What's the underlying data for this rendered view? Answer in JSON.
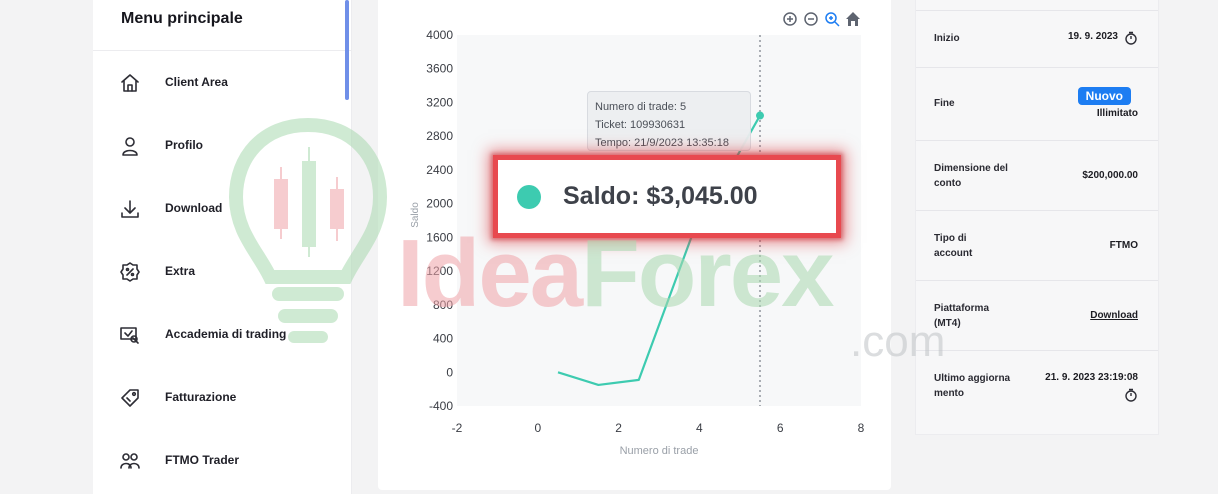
{
  "sidebar": {
    "title": "Menu principale",
    "items": [
      {
        "label": "Client Area",
        "icon": "home-icon"
      },
      {
        "label": "Profilo",
        "icon": "user-icon"
      },
      {
        "label": "Download",
        "icon": "download-icon"
      },
      {
        "label": "Extra",
        "icon": "percent-badge-icon"
      },
      {
        "label": "Accademia di trading",
        "icon": "academy-icon"
      },
      {
        "label": "Fatturazione",
        "icon": "tag-icon"
      },
      {
        "label": "FTMO Trader",
        "icon": "users-icon"
      }
    ]
  },
  "chart": {
    "tools": [
      "zoom-in-icon",
      "zoom-out-icon",
      "magnifier-icon",
      "home-reset-icon"
    ],
    "tooltip": {
      "line1": "Numero di trade: 5",
      "line2": "Ticket: 109930631",
      "line3": "Tempo: 21/9/2023 13:35:18"
    },
    "saldo_label": "Saldo: $3,045.00",
    "saldo_color": "#3dcbb0"
  },
  "chart_data": {
    "type": "line",
    "xlabel": "Numero di trade",
    "ylabel": "Saldo",
    "xlim": [
      -2,
      8
    ],
    "ylim": [
      -400,
      4000
    ],
    "x_ticks": [
      "-2",
      "0",
      "2",
      "4",
      "6",
      "8"
    ],
    "y_ticks": [
      "4000",
      "3600",
      "3200",
      "2800",
      "2400",
      "2000",
      "1600",
      "1200",
      "800",
      "400",
      "0",
      "-400"
    ],
    "series": [
      {
        "x": [
          0.5,
          1.5,
          2.5,
          3.8,
          5.5
        ],
        "y": [
          0,
          -150,
          -90,
          1600,
          3045
        ],
        "color": "#3dcbb0"
      }
    ],
    "cursor_x": 5.5
  },
  "details": {
    "rows": [
      {
        "label": "Inizio",
        "value": "19. 9. 2023"
      },
      {
        "label": "Fine",
        "badge": "Nuovo",
        "value": "Illimitato"
      },
      {
        "label": "Dimensione del conto",
        "value": "$200,000.00"
      },
      {
        "label": "Tipo di account",
        "value": "FTMO"
      },
      {
        "label": "Piattaforma (MT4)",
        "value": "Download"
      },
      {
        "label": "Ultimo aggiornamento",
        "value": "21. 9. 2023 23:19:08"
      }
    ]
  },
  "watermark": {
    "idea": "Idea",
    "forex": "Forex",
    "com": ".com"
  }
}
